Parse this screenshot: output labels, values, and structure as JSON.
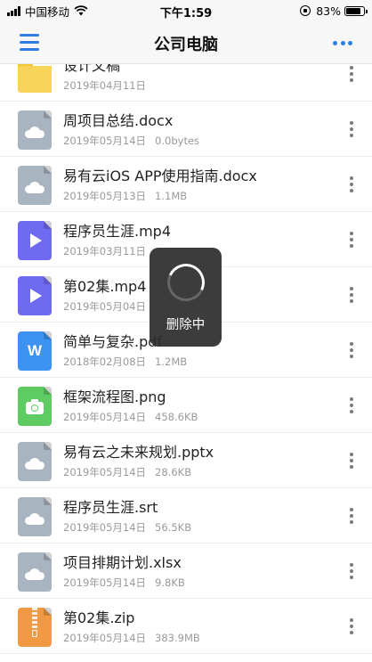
{
  "status_bar": {
    "carrier": "中国移动",
    "time": "下午1:59",
    "battery": "83%",
    "battery_level": 0.83,
    "signal_icon": "signal-icon",
    "wifi_icon": "wifi-icon",
    "lock_icon": "orientation-lock-icon",
    "battery_icon": "battery-icon"
  },
  "nav": {
    "title": "公司电脑",
    "menu_icon": "hamburger-menu-icon",
    "more_icon": "more-horizontal-icon",
    "accent_color": "#2f7de1"
  },
  "files": [
    {
      "name": "设计文稿",
      "date": "2019年04月11日",
      "size": "",
      "icon": "folder-icon"
    },
    {
      "name": "周项目总结.docx",
      "date": "2019年05月14日",
      "size": "0.0bytes",
      "icon": "cloud-file-icon"
    },
    {
      "name": "易有云iOS APP使用指南.docx",
      "date": "2019年05月13日",
      "size": "1.1MB",
      "icon": "cloud-file-icon"
    },
    {
      "name": "程序员生涯.mp4",
      "date": "2019年03月11日",
      "size": "",
      "icon": "video-file-icon"
    },
    {
      "name": "第02集.mp4",
      "date": "2019年05月04日",
      "size": "",
      "icon": "video-file-icon"
    },
    {
      "name": "简单与复杂.pdf",
      "date": "2018年02月08日",
      "size": "1.2MB",
      "icon": "word-file-icon"
    },
    {
      "name": "框架流程图.png",
      "date": "2019年05月14日",
      "size": "458.6KB",
      "icon": "image-file-icon"
    },
    {
      "name": "易有云之未来规划.pptx",
      "date": "2019年05月14日",
      "size": "28.6KB",
      "icon": "cloud-file-icon"
    },
    {
      "name": "程序员生涯.srt",
      "date": "2019年05月14日",
      "size": "56.5KB",
      "icon": "cloud-file-icon"
    },
    {
      "name": "项目排期计划.xlsx",
      "date": "2019年05月14日",
      "size": "9.8KB",
      "icon": "cloud-file-icon"
    },
    {
      "name": "第02集.zip",
      "date": "2019年05月14日",
      "size": "383.9MB",
      "icon": "zip-file-icon"
    }
  ],
  "toast": {
    "text": "删除中",
    "icon": "loading-spinner-icon"
  }
}
